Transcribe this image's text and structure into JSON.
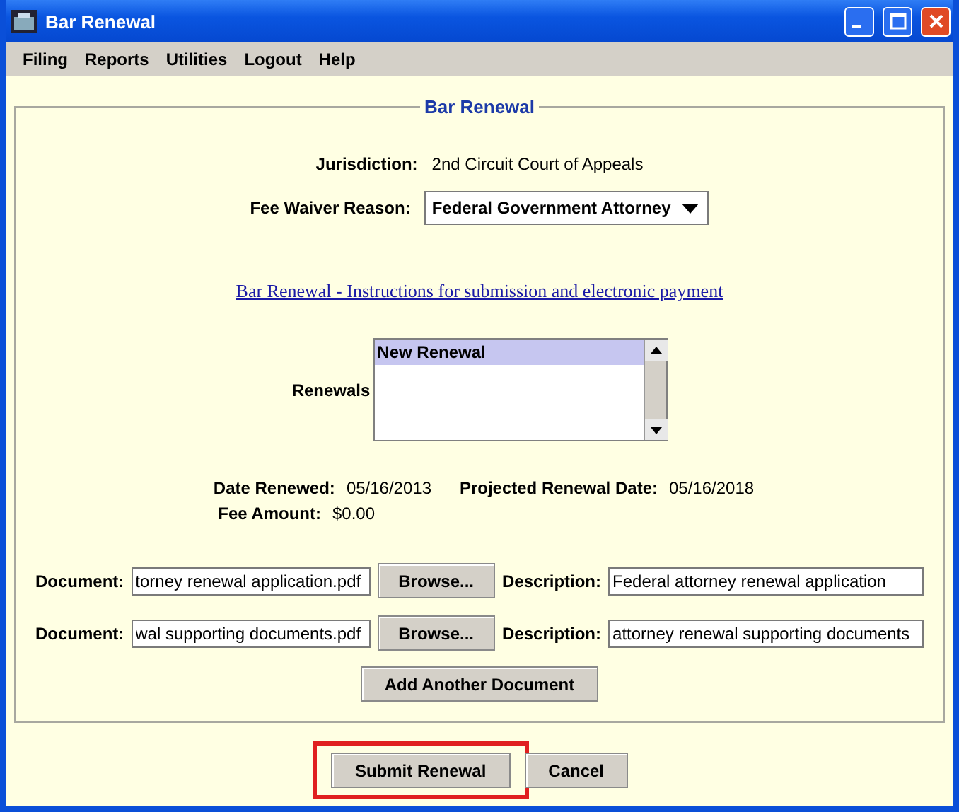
{
  "window": {
    "title": "Bar Renewal"
  },
  "menu": [
    "Filing",
    "Reports",
    "Utilities",
    "Logout",
    "Help"
  ],
  "form": {
    "title": "Bar Renewal",
    "jurisdiction": {
      "label": "Jurisdiction:",
      "value": "2nd Circuit Court of Appeals"
    },
    "fee_waiver": {
      "label": "Fee Waiver Reason:",
      "value": "Federal Government Attorney"
    },
    "link": "Bar Renewal - Instructions for submission and electronic payment",
    "renewals": {
      "label": "Renewals",
      "items": [
        {
          "text": "New Renewal",
          "selected": true
        }
      ]
    },
    "date_renewed": {
      "label": "Date Renewed:",
      "value": "05/16/2013"
    },
    "projected": {
      "label": "Projected Renewal Date:",
      "value": "05/16/2018"
    },
    "fee_amount": {
      "label": "Fee Amount:",
      "value": "$0.00"
    },
    "documents": [
      {
        "label": "Document:",
        "file": "torney renewal application.pdf",
        "browse": "Browse...",
        "description_label": "Description:",
        "description": "Federal attorney renewal application"
      },
      {
        "label": "Document:",
        "file": "wal supporting documents.pdf",
        "browse": "Browse...",
        "description_label": "Description:",
        "description": "attorney renewal supporting documents"
      }
    ],
    "add_document": "Add Another Document"
  },
  "buttons": [
    {
      "label": "Submit Renewal",
      "highlighted": true
    },
    {
      "label": "Cancel",
      "highlighted": false
    }
  ]
}
